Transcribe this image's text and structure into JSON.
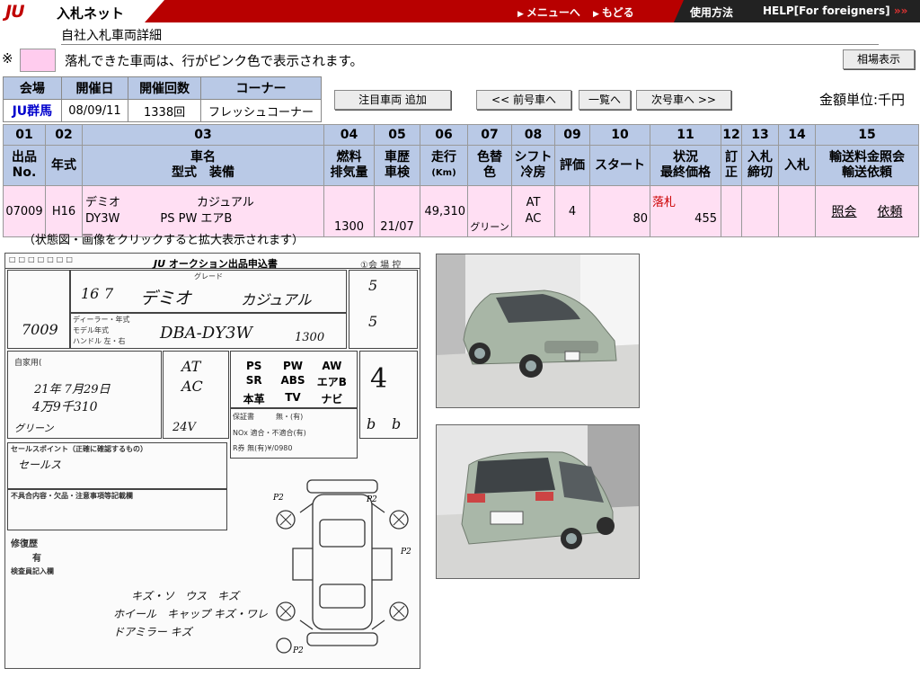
{
  "header": {
    "logo": "JU",
    "logo_sub": "入札ネット",
    "nav_menu": "メニューへ",
    "nav_back": "もどる",
    "usage": "使用方法",
    "help": "HELP[For foreigners]",
    "help_arrows": "»»"
  },
  "page": {
    "subtitle": "自社入札車両詳細",
    "note_mark": "※",
    "note": "落札できた車両は、行がピンク色で表示されます。",
    "market_btn": "相場表示",
    "unit": "金額単位:千円",
    "click_note": "（状態図・画像をクリックすると拡大表示されます）"
  },
  "colors": {
    "header_red": "#b80000",
    "header_dark": "#222222",
    "table_head": "#b9c9e6",
    "won_row": "#ffdff3"
  },
  "auction": {
    "headers": [
      "会場",
      "開催日",
      "開催回数",
      "コーナー"
    ],
    "venue": "JU群馬",
    "date": "08/09/11",
    "session": "1338回",
    "corner": "フレッシュコーナー"
  },
  "buttons": {
    "watch_add": "注目車両 追加",
    "prev": "<< 前号車へ",
    "list": "一覧へ",
    "next": "次号車へ >>"
  },
  "vehicle_table": {
    "col_nums": [
      "01",
      "02",
      "03",
      "04",
      "05",
      "06",
      "07",
      "08",
      "09",
      "10",
      "11",
      "12",
      "13",
      "14",
      "15"
    ],
    "labels": {
      "c01a": "出品",
      "c01b": "No.",
      "c02": "年式",
      "c03a": "車名",
      "c03b": "型式　装備",
      "c04a": "燃料",
      "c04b": "排気量",
      "c05a": "車歴",
      "c05b": "車検",
      "c06a": "走行",
      "c06b": "(Km)",
      "c07a": "色替",
      "c07b": "色",
      "c08a": "シフト",
      "c08b": "冷房",
      "c09": "評価",
      "c10": "スタート",
      "c11a": "状況",
      "c11b": "最終価格",
      "c12a": "訂",
      "c12b": "正",
      "c13a": "入札",
      "c13b": "締切",
      "c14": "入札",
      "c15a": "輸送料金照会",
      "c15b": "輸送依頼"
    },
    "row": {
      "lot": "07009",
      "year": "H16",
      "name": "デミオ",
      "grade": "カジュアル",
      "model": "DY3W",
      "equipment": "PS PW エアB",
      "displacement": "1300",
      "inspection": "21/07",
      "mileage": "49,310",
      "color": "グリーン",
      "shift": "AT",
      "ac": "AC",
      "score": "4",
      "start": "80",
      "status": "落札",
      "final_price": "455",
      "inquiry": "照会",
      "request": "依頼"
    }
  },
  "sheet": {
    "title": "オークション出品申込書",
    "venue_label": "①会 場 控",
    "label_grade": "グレード",
    "label_dealer": "ディーラー・年式",
    "label_model_year": "モデル年式",
    "label_handle": "ハンドル 左・右",
    "label_usage": "自家用(",
    "label_sales_point": "セールスポイント（正確に確認するもの）",
    "label_defects": "不具合内容・欠品・注意事項等記載欄",
    "label_repair": "修復歴",
    "label_repair_yes": "有",
    "label_inspector": "検査員記入欄",
    "label_warranty": "保証書　　　無・(有)",
    "label_nox": "NOx 適合・不適合(有)",
    "label_recycle": "R券 無(有)¥/0980",
    "equip_grid": [
      "PS",
      "PW",
      "AW",
      "SR",
      "ABS",
      "エアB",
      "本革",
      "TV",
      "ナビ"
    ],
    "hw_year": "16",
    "hw_month": "7",
    "hw_name": "デミオ",
    "hw_grade": "カジュアル",
    "hw_lot": "7009",
    "hw_model": "DBA-DY3W",
    "hw_cc": "1300",
    "hw_shift": "AT",
    "hw_ac": "AC",
    "hw_score": "4",
    "hw_inspect_date": "21年 7月29日",
    "hw_mileage": "4万9千310",
    "hw_color": "グリーン",
    "hw_seats": "5",
    "hw_doors": "5",
    "hw_volt": "24V",
    "hw_exterior": "b",
    "hw_interior": "b",
    "hw_sales": "セールス",
    "hw_notes1": "キズ・ソ　ウス　キズ",
    "hw_notes2": "ホイール　キャップ キズ・ワレ",
    "hw_notes3": "ドアミラー キズ",
    "mark_p2": "P2"
  },
  "photos": [
    "front-view-photo",
    "rear-view-photo"
  ]
}
